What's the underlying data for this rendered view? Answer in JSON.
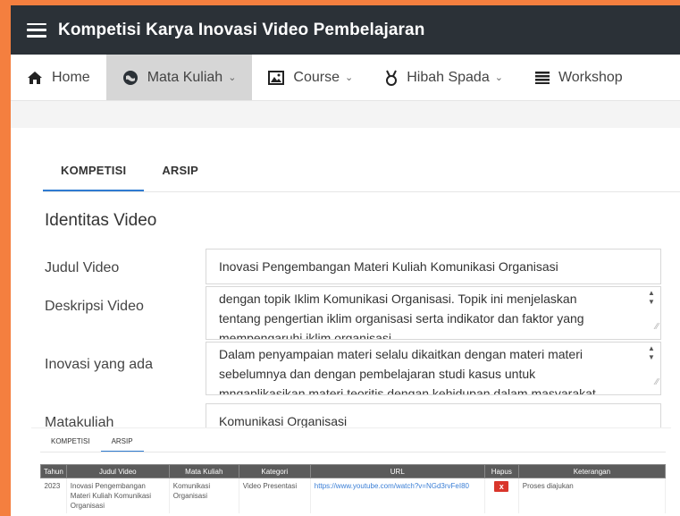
{
  "header": {
    "title": "Kompetisi Karya Inovasi Video Pembelajaran"
  },
  "nav": {
    "items": [
      {
        "label": "Home",
        "icon": "home-icon"
      },
      {
        "label": "Mata Kuliah",
        "icon": "globe-icon",
        "dropdown": true
      },
      {
        "label": "Course",
        "icon": "image-icon",
        "dropdown": true
      },
      {
        "label": "Hibah Spada",
        "icon": "medal-icon",
        "dropdown": true
      },
      {
        "label": "Workshop",
        "icon": "list-icon"
      }
    ]
  },
  "tabs": {
    "kompetisi": "KOMPETISI",
    "arsip": "ARSIP"
  },
  "form": {
    "section_title": "Identitas Video",
    "judul_label": "Judul Video",
    "judul_value": "Inovasi Pengembangan Materi Kuliah  Komunikasi Organisasi",
    "deskripsi_label": "Deskripsi Video",
    "deskripsi_lines": [
      "dengan topik Iklim Komunikasi Organisasi. Topik ini menjelaskan",
      "tentang pengertian iklim organisasi serta indikator dan faktor yang",
      "mempengaruhi iklim organisasi."
    ],
    "inovasi_label": "Inovasi yang ada",
    "inovasi_lines": [
      "Dalam penyampaian materi selalu dikaitkan dengan materi materi",
      "sebelumnya dan dengan pembelajaran studi kasus untuk"
    ],
    "inovasi_line3_a": "mngaplikasikan",
    "inovasi_line3_b": " materi ",
    "inovasi_line3_c": "teoritis",
    "inovasi_line3_d": " dengan kehidupan dalam masyarakat",
    "matakuliah_label": "Matakuliah",
    "matakuliah_value": "Komunikasi Organisasi"
  },
  "arsip": {
    "tabs": {
      "kompetisi": "KOMPETISI",
      "arsip": "ARSIP"
    },
    "columns": [
      "Tahun",
      "Judul Video",
      "Mata Kuliah",
      "Kategori",
      "URL",
      "Hapus",
      "Keterangan"
    ],
    "rows": [
      {
        "tahun": "2023",
        "judul": "Inovasi Pengembangan Materi Kuliah Komunikasi Organisasi",
        "mata_kuliah": "Komunikasi Organisasi",
        "kategori": "Video Presentasi",
        "url": "https://www.youtube.com/watch?v=NGd3rvFeI80",
        "hapus": "x",
        "keterangan": "Proses diajukan"
      }
    ]
  },
  "colors": {
    "accent": "#2f7bd1",
    "topbar": "#2b3137",
    "border_frame": "#f47f3f",
    "delete": "#d9362b"
  }
}
